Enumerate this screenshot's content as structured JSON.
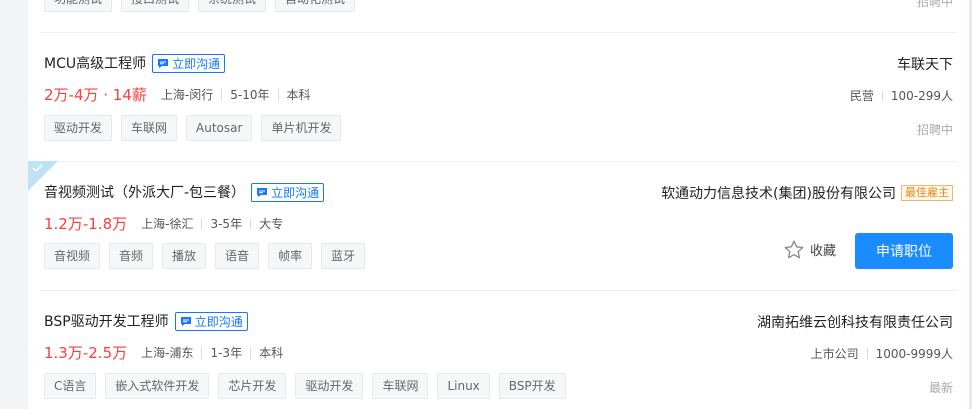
{
  "top_partial": {
    "tags": [
      "功能测试",
      "接口测试",
      "系统测试",
      "自动化测试"
    ],
    "status": "招聘中"
  },
  "jobs": [
    {
      "title": "MCU高级工程师",
      "chat_label": "立即沟通",
      "salary": "2万-4万 · 14薪",
      "location": "上海-闵行",
      "experience": "5-10年",
      "education": "本科",
      "tags": [
        "驱动开发",
        "车联网",
        "Autosar",
        "单片机开发"
      ],
      "company": "车联天下",
      "company_type": "民营",
      "company_size": "100-299人",
      "status": "招聘中"
    },
    {
      "title": "音视频测试（外派大厂-包三餐）",
      "chat_label": "立即沟通",
      "salary": "1.2万-1.8万",
      "location": "上海-徐汇",
      "experience": "3-5年",
      "education": "大专",
      "tags": [
        "音视频",
        "音频",
        "播放",
        "语音",
        "帧率",
        "蓝牙"
      ],
      "company": "软通动力信息技术(集团)股份有限公司",
      "badge": "最佳雇主",
      "favorite_label": "收藏",
      "apply_label": "申请职位"
    },
    {
      "title": "BSP驱动开发工程师",
      "chat_label": "立即沟通",
      "salary": "1.3万-2.5万",
      "location": "上海-浦东",
      "experience": "1-3年",
      "education": "本科",
      "tags": [
        "C语言",
        "嵌入式软件开发",
        "芯片开发",
        "驱动开发",
        "车联网",
        "Linux",
        "BSP开发"
      ],
      "company": "湖南拓维云创科技有限责任公司",
      "company_type": "上市公司",
      "company_size": "1000-9999人",
      "status": "最新"
    }
  ],
  "colors": {
    "accent": "#1677ff",
    "salary": "#fa3e3e",
    "apply_bg": "#1a8cff",
    "badge": "#e8870c"
  }
}
